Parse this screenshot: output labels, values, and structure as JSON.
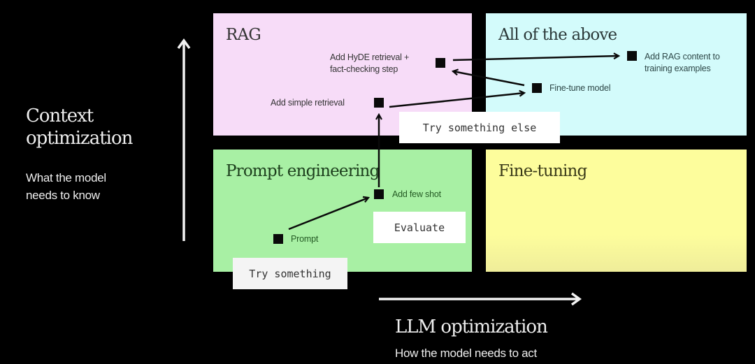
{
  "axes": {
    "y": {
      "title_line1": "Context",
      "title_line2": "optimization",
      "subtitle_line1": "What the model",
      "subtitle_line2": "needs to know"
    },
    "x": {
      "title": "LLM optimization",
      "subtitle": "How the model needs to act"
    }
  },
  "quadrants": {
    "rag": {
      "title": "RAG",
      "color": "#f7dcf8"
    },
    "all": {
      "title": "All of the above",
      "color": "#d3fbfb"
    },
    "prompt": {
      "title": "Prompt engineering",
      "color": "#a8f0a4"
    },
    "finetuning": {
      "title": "Fine-tuning",
      "color": "#fdfd9c"
    }
  },
  "nodes": {
    "prompt": "Prompt",
    "few_shot": "Add few shot",
    "simple_retrieval": "Add simple retrieval",
    "hyde_line1": "Add HyDE retrieval +",
    "hyde_line2": "fact-checking step",
    "fine_tune": "Fine-tune model",
    "rag_content_line1": "Add RAG content to",
    "rag_content_line2": "training examples"
  },
  "steps": {
    "try_something": "Try something",
    "evaluate": "Evaluate",
    "try_something_else": "Try something else"
  }
}
